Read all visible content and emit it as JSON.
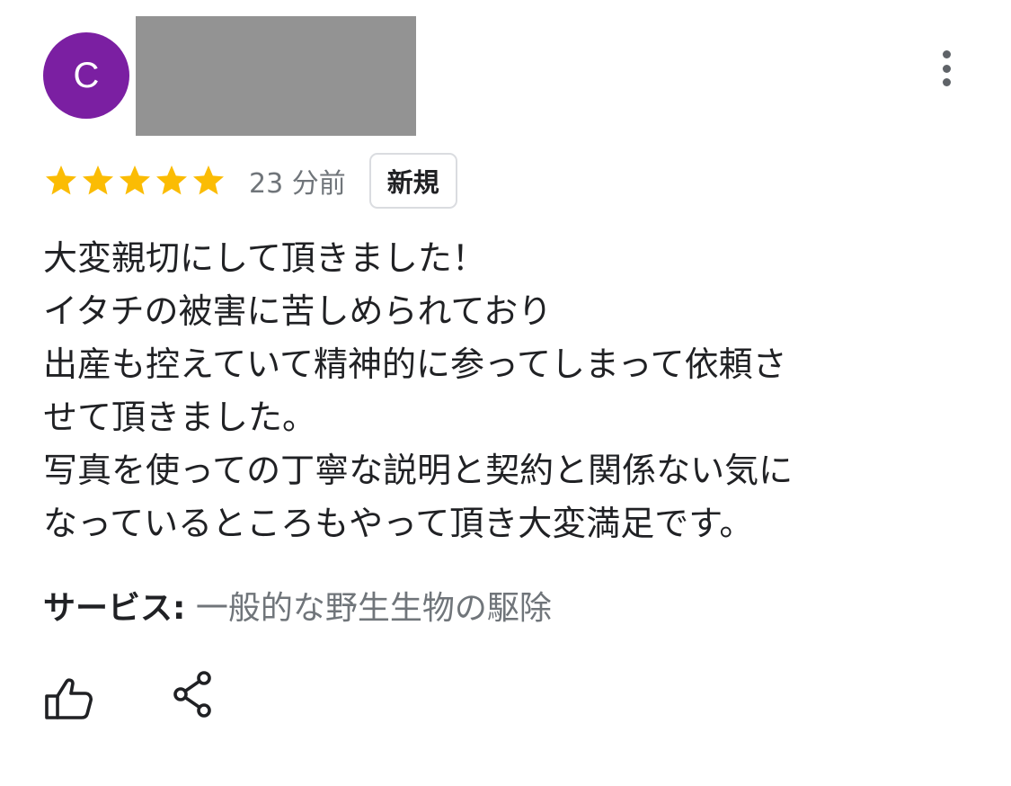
{
  "colors": {
    "avatar_bg": "#7b1fa2",
    "star": "#fbbc04",
    "redacted": "#939393",
    "secondary_text": "#70757a",
    "primary_text": "#202124"
  },
  "reviewer": {
    "avatar_initial": "C"
  },
  "review": {
    "rating": 5,
    "rating_max": 5,
    "time_ago": "23 分前",
    "badge": "新規",
    "lines": [
      "大変親切にして頂きました！",
      "イタチの被害に苦しめられており",
      "出産も控えていて精神的に参ってしまって依頼さ",
      "せて頂きました。",
      "写真を使っての丁寧な説明と契約と関係ない気に",
      "なっているところもやって頂き大変満足です。"
    ],
    "service_label": "サービス:",
    "service_value": "一般的な野生生物の駆除"
  },
  "icons": {
    "more": "more-vert-icon",
    "like": "thumb-up-icon",
    "share": "share-icon",
    "star": "star-icon"
  }
}
